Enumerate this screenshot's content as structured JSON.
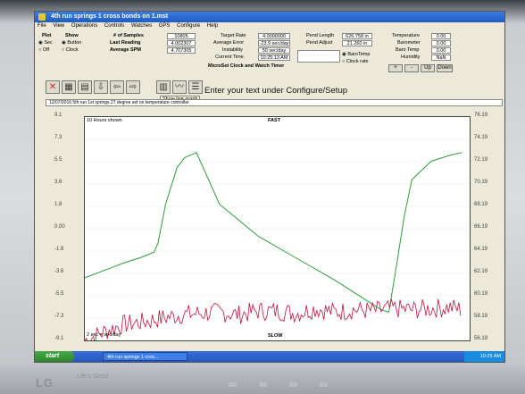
{
  "window": {
    "title": "4th run springs 1 cross bonds on 1.mst"
  },
  "menu": [
    "File",
    "View",
    "Operations",
    "Controls",
    "Watches",
    "GPS",
    "Configure",
    "Help"
  ],
  "plot_group": {
    "label": "Plot",
    "options": [
      "Sec",
      "Off"
    ]
  },
  "show_group": {
    "label": "Show",
    "options": [
      "Button",
      "Clock"
    ]
  },
  "left_stats": [
    {
      "label": "# of Samples",
      "value": "10805"
    },
    {
      "label": "Last Reading",
      "value": "4.002307"
    },
    {
      "label": "Average SPM",
      "value": "4.707305"
    }
  ],
  "mid_stats": [
    {
      "label": "Target Rate",
      "value": "4.0000000"
    },
    {
      "label": "Average Error",
      "value": "-23.9 sec/day"
    },
    {
      "label": "Instability",
      "value": "50 sec/day"
    },
    {
      "label": "Current Time",
      "value": "10:25:13 AM"
    }
  ],
  "mid_title": "MicroSet Clock and Watch Timer",
  "pend": [
    {
      "label": "Pend Length",
      "value": "626.758 in"
    },
    {
      "label": "Pend Adjust",
      "value": "21.260 in"
    }
  ],
  "radio_bar": {
    "label": "BaroTemp"
  },
  "radio_clock": {
    "label": "Clock rate"
  },
  "env": [
    {
      "label": "Temperature",
      "value": "0.00"
    },
    {
      "label": "Barometer",
      "value": "0.00"
    },
    {
      "label": "Baro Temp",
      "value": "0.00"
    },
    {
      "label": "Humidity",
      "value": "NaN"
    }
  ],
  "small_buttons": [
    "+",
    "-",
    "Up",
    "Down"
  ],
  "tooltip": "Show line graph",
  "headline": "Enter your text under Configure/Setup",
  "infobar": "12/07/2016 5th run 1st springs 27 degree set on temperature controller",
  "plot": {
    "top_label": "FAST",
    "bottom_label": "SLOW",
    "corner_top": "10 Hours shown",
    "corner_bottom": "2 sec = sec/day"
  },
  "colors": {
    "green_series": "#2f9e3a",
    "red_series": "#c0143c",
    "purple_series": "#5a2a8a"
  },
  "taskbar": {
    "start": "start",
    "task": "4th run springs 1 cros...",
    "clock": "10:25 AM"
  },
  "brand": {
    "logo": "LG",
    "model": "Life's Good"
  },
  "chart_data": {
    "type": "line",
    "xlabel": "",
    "ylabel": "",
    "left_ticks": [
      "9.1",
      "7.3",
      "5.5",
      "3.6",
      "1.8",
      "0.00",
      "-1.8",
      "-3.6",
      "-5.5",
      "-7.3",
      "-9.1"
    ],
    "right_ticks": [
      "76.19",
      "74.19",
      "72.19",
      "70.19",
      "68.19",
      "66.19",
      "64.19",
      "62.19",
      "60.19",
      "58.19",
      "56.19"
    ],
    "series": [
      {
        "name": "green",
        "x": [
          0,
          5,
          10,
          15,
          18,
          19,
          21,
          24,
          26,
          29,
          35,
          45,
          55,
          65,
          70,
          75,
          77,
          79,
          81,
          83,
          85,
          90,
          95,
          98
        ],
        "y": [
          -4.0,
          -3.4,
          -2.8,
          -2.3,
          -1.9,
          -1.2,
          2.0,
          5.0,
          5.8,
          6.2,
          2.0,
          -0.6,
          -2.4,
          -4.2,
          -5.2,
          -6.2,
          -6.6,
          -6.8,
          -3.0,
          1.0,
          4.0,
          5.5,
          6.0,
          6.2
        ]
      },
      {
        "name": "red",
        "x": [
          0,
          5,
          10,
          15,
          20,
          25,
          30,
          35,
          40,
          45,
          50,
          55,
          60,
          65,
          70,
          75,
          80,
          85,
          90,
          95,
          98
        ],
        "y": [
          -9.1,
          -8.4,
          -7.8,
          -7.6,
          -7.3,
          -7.0,
          -6.9,
          -6.8,
          -7.0,
          -6.7,
          -6.7,
          -6.9,
          -6.5,
          -6.8,
          -6.6,
          -6.7,
          -6.5,
          -6.6,
          -6.5,
          -6.4,
          -6.6
        ]
      }
    ]
  }
}
